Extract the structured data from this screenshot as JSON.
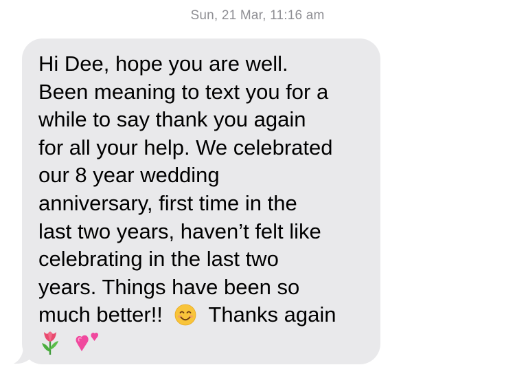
{
  "conversation": {
    "timestamp": "Sun, 21 Mar, 11:16 am"
  },
  "message": {
    "direction": "incoming",
    "bubble_color": "#e9e9eb",
    "text_color": "#000000",
    "lines": [
      "Hi Dee, hope you are well.",
      "Been meaning to text you for a",
      "while to say thank you again",
      "for all your help. We celebrated",
      "our 8 year wedding",
      "anniversary, first time in the",
      "last two years, haven’t felt like",
      "celebrating in the last two",
      "years. Things have been so"
    ],
    "line_10_before": "much better!!",
    "line_10_emoji": "smiling-face-with-smiling-eyes",
    "line_10_after": "Thanks again",
    "line_11_emojis": [
      "tulip",
      "two-hearts"
    ]
  }
}
